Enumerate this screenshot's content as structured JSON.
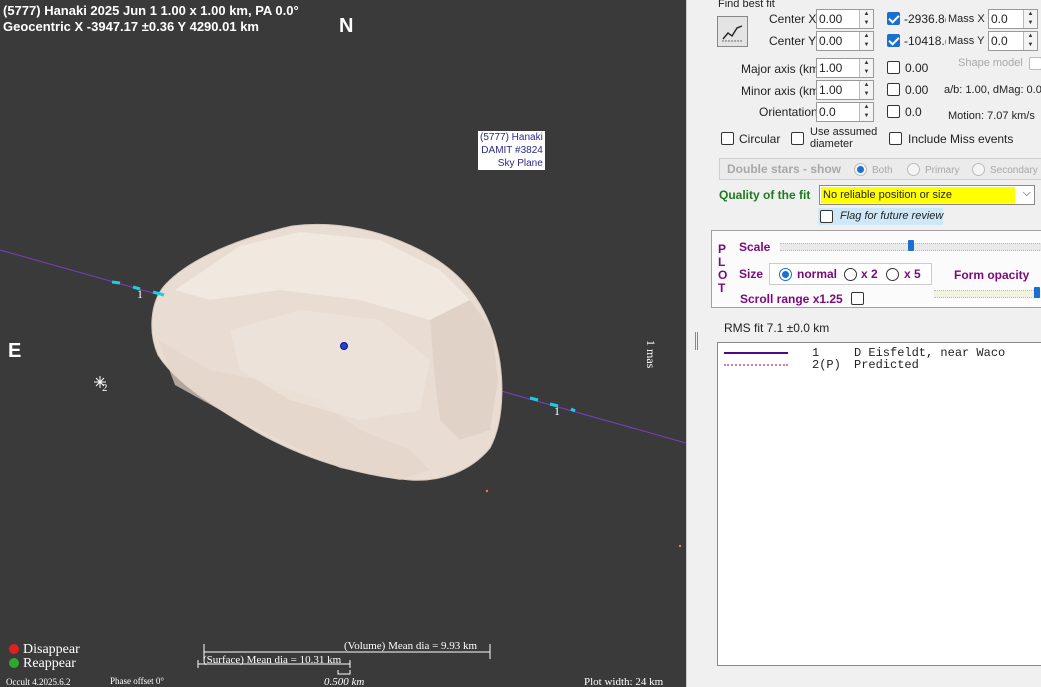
{
  "plot": {
    "header_line1": "(5777) Hanaki  2025 Jun 1   1.00 x 1.00 km, PA 0.0°",
    "header_line2": "Geocentric  X  -3947.17 ±0.36  Y 4290.01 km",
    "north": "N",
    "east": "E",
    "model_label": {
      "line1": "(5777) Hanaki",
      "line2": "DAMIT #3824",
      "line3": "Sky Plane"
    },
    "chord_label_left": "1",
    "chord_label_right": "1",
    "star_label": "2",
    "scale_label": "1 mas",
    "legend": {
      "disappear": "Disappear",
      "reappear": "Reappear",
      "disappear_color": "#e02020",
      "reappear_color": "#2ea82e"
    },
    "volume_dia": "(Volume) Mean dia = 9.93 km",
    "surface_dia": "(Surface) Mean dia = 10.31 km",
    "scale_bar": "0.500 km",
    "version": "Occult 4.2025.6.2",
    "phase_offset": "Phase offset 0°",
    "plot_width": "Plot width: 24 km",
    "chord_color": "#7a3fc0",
    "marker_color": "#19d0e0",
    "body_color": "#eadfd6"
  },
  "panel": {
    "find_best_fit": "Find best fit",
    "center_x_label": "Center X",
    "center_x_value": "0.00",
    "center_y_label": "Center Y",
    "center_y_value": "0.00",
    "fit_x_value": "-2936.8(",
    "fit_y_value": "-10418.(",
    "mass_x_label": "Mass X",
    "mass_x_value": "0.0",
    "mass_y_label": "Mass Y",
    "mass_y_value": "0.0",
    "shape_model": "Shape model",
    "major_axis_label": "Major axis (km)",
    "major_axis_value": "1.00",
    "major_axis_result": "0.00",
    "minor_axis_label": "Minor axis (km)",
    "minor_axis_value": "1.00",
    "minor_axis_result": "0.00",
    "ab_dmag": "a/b: 1.00, dMag: 0.0",
    "orientation_label": "Orientation",
    "orientation_value": "0.0",
    "orientation_result": "0.0",
    "motion": "Motion: 7.07 km/s",
    "circular": "Circular",
    "use_assumed_1": "Use assumed",
    "use_assumed_2": "diameter",
    "include_miss": "Include Miss events",
    "double_stars": "Double stars - show",
    "both": "Both",
    "primary": "Primary",
    "secondary": "Secondary",
    "quality_label": "Quality of the fit",
    "quality_value": "No reliable position or size",
    "flag_future": "Flag for future review",
    "plot_vertical": [
      "P",
      "L",
      "O",
      "T"
    ],
    "scale_label": "Scale",
    "size_label": "Size",
    "size_normal": "normal",
    "size_x2": "x 2",
    "size_x5": "x 5",
    "form_opacity": "Form opacity",
    "scroll_range": "Scroll range x1.25",
    "rms_fit": "RMS fit 7.1 ±0.0 km",
    "observers": [
      {
        "num": "1",
        "name": "D Eisfeldt, near Waco"
      },
      {
        "num": "2(P)",
        "name": "Predicted"
      }
    ]
  }
}
